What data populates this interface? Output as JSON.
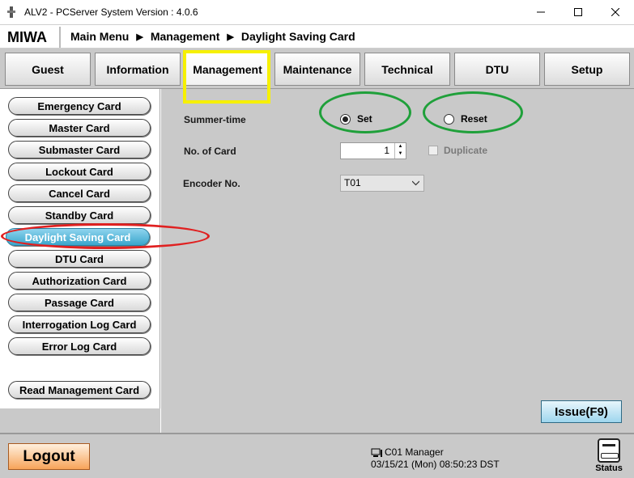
{
  "window": {
    "title": "ALV2 - PCServer System Version : 4.0.6",
    "minimize_glyph": "—",
    "maximize_glyph": "☐",
    "close_glyph": "✕"
  },
  "header": {
    "brand": "MIWA",
    "breadcrumb": [
      "Main Menu",
      "Management",
      "Daylight Saving Card"
    ],
    "separator": "▶"
  },
  "tabs": [
    {
      "label": "Guest"
    },
    {
      "label": "Information"
    },
    {
      "label": "Management",
      "active": true
    },
    {
      "label": "Maintenance"
    },
    {
      "label": "Technical"
    },
    {
      "label": "DTU"
    },
    {
      "label": "Setup"
    }
  ],
  "sidebar": {
    "items": [
      {
        "label": "Emergency Card"
      },
      {
        "label": "Master Card"
      },
      {
        "label": "Submaster Card"
      },
      {
        "label": "Lockout Card"
      },
      {
        "label": "Cancel Card"
      },
      {
        "label": "Standby Card"
      },
      {
        "label": "Daylight Saving Card",
        "active": true
      },
      {
        "label": "DTU Card"
      },
      {
        "label": "Authorization Card"
      },
      {
        "label": "Passage Card"
      },
      {
        "label": "Interrogation Log Card"
      },
      {
        "label": "Error Log Card"
      }
    ],
    "read_button": "Read Management Card"
  },
  "form": {
    "summer_time_label": "Summer-time",
    "set_label": "Set",
    "reset_label": "Reset",
    "selected": "Set",
    "num_card_label": "No. of Card",
    "num_card_value": "1",
    "duplicate_label": "Duplicate",
    "encoder_label": "Encoder No.",
    "encoder_value": "T01"
  },
  "issue_button": "Issue(F9)",
  "status": {
    "logout": "Logout",
    "user": "C01 Manager",
    "datetime": "03/15/21 (Mon) 08:50:23 DST",
    "status_label": "Status"
  },
  "colors": {
    "annotation_yellow": "#f6f000",
    "annotation_red": "#e02020",
    "annotation_green": "#1fa03a",
    "panel_gray": "#c9c9c9",
    "active_blue": "#3aa6cc"
  }
}
